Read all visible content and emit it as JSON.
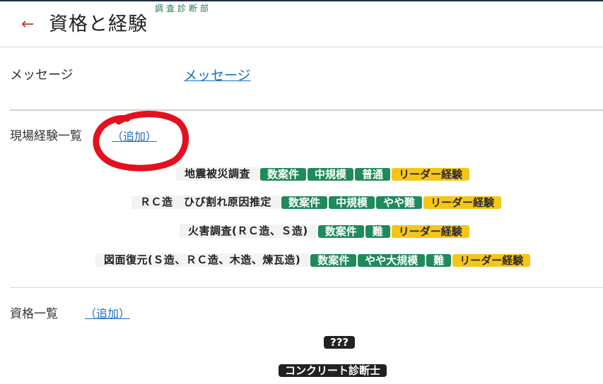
{
  "header": {
    "back_icon": "←",
    "title": "資格と経験",
    "dept": "調査診断部"
  },
  "message": {
    "label": "メッセージ",
    "link": "メッセージ"
  },
  "experience": {
    "label": "現場経験一覧",
    "add": "（追加）",
    "items": [
      {
        "title": "地震被災調査",
        "tags": [
          "数案件",
          "中規模",
          "普通",
          "リーダー経験"
        ]
      },
      {
        "title": "ＲＣ造　ひび割れ原因推定",
        "tags": [
          "数案件",
          "中規模",
          "やや難",
          "リーダー経験"
        ]
      },
      {
        "title": "火害調査(ＲＣ造、Ｓ造)",
        "tags": [
          "数案件",
          "難",
          "リーダー経験"
        ]
      },
      {
        "title": "図面復元(Ｓ造、ＲＣ造、木造、煉瓦造)",
        "tags": [
          "数案件",
          "やや大規模",
          "難",
          "リーダー経験"
        ]
      }
    ]
  },
  "qualifications": {
    "label": "資格一覧",
    "add": "（追加）",
    "items": [
      "???",
      "コンクリート診断士"
    ]
  },
  "colors": {
    "tag_green": "#1f8a5b",
    "tag_yellow": "#f5c518",
    "link": "#1a6fc7",
    "back_arrow": "#c0392b",
    "annotation_circle": "#e3101e"
  }
}
